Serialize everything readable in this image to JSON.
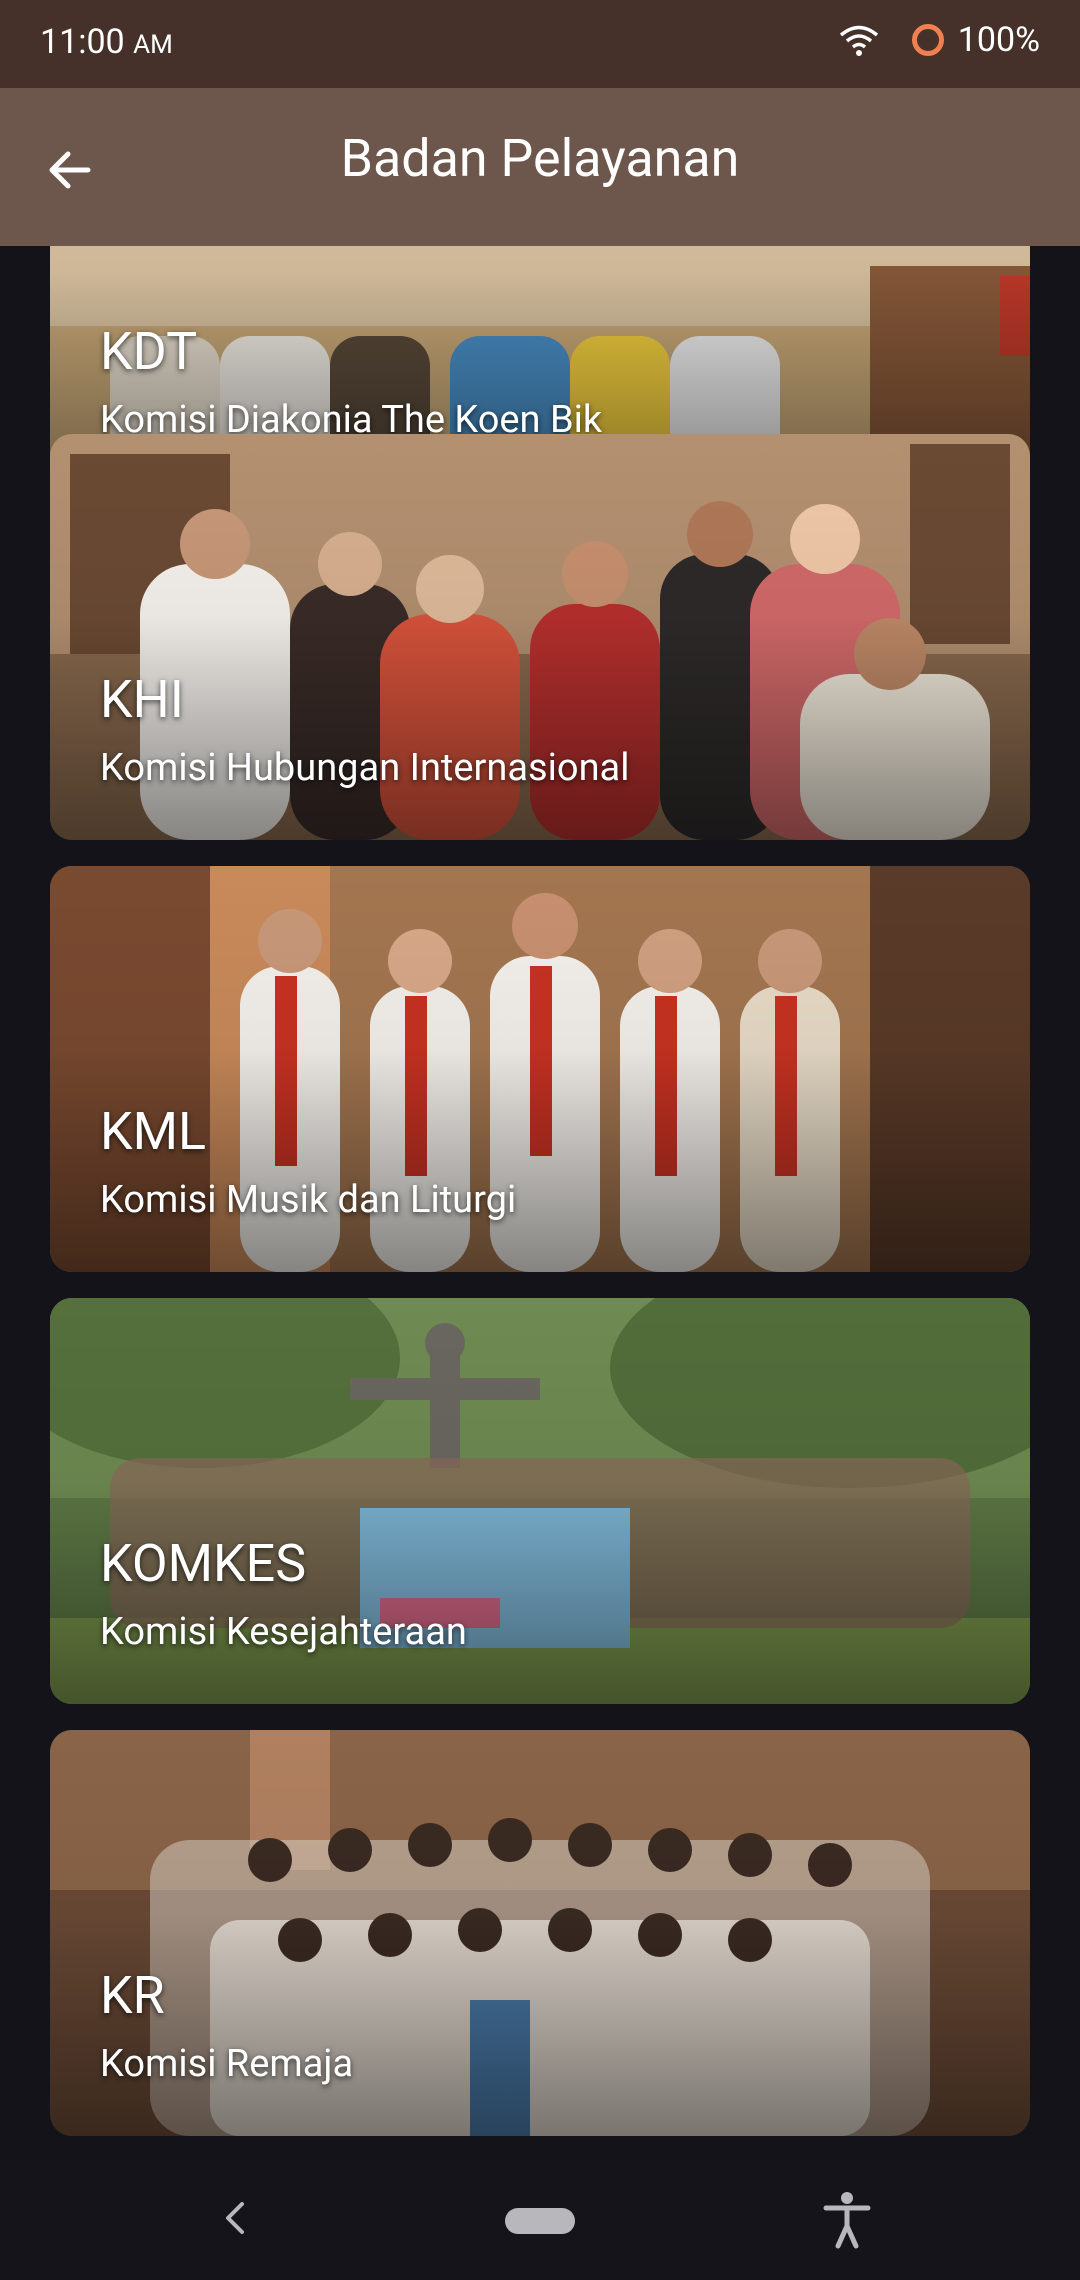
{
  "status_bar": {
    "time": "11:00",
    "ampm": "AM",
    "battery": "100%"
  },
  "app_bar": {
    "title": "Badan Pelayanan"
  },
  "cards": [
    {
      "abbr": "KDT",
      "name": "Komisi Diakonia The Koen Bik"
    },
    {
      "abbr": "KHI",
      "name": "Komisi Hubungan Internasional"
    },
    {
      "abbr": "KML",
      "name": "Komisi Musik dan Liturgi"
    },
    {
      "abbr": "KOMKES",
      "name": "Komisi Kesejahteraan"
    },
    {
      "abbr": "KR",
      "name": "Komisi Remaja"
    }
  ],
  "colors": {
    "status_bar": "#45312a",
    "app_bar": "#6d564b",
    "background": "#14131a",
    "battery_ring": "#f08050"
  },
  "icons": {
    "back": "arrow-back-icon",
    "wifi": "wifi-icon",
    "battery": "battery-icon",
    "nav_back": "nav-back-icon",
    "nav_home": "nav-home-pill",
    "accessibility": "accessibility-icon"
  }
}
